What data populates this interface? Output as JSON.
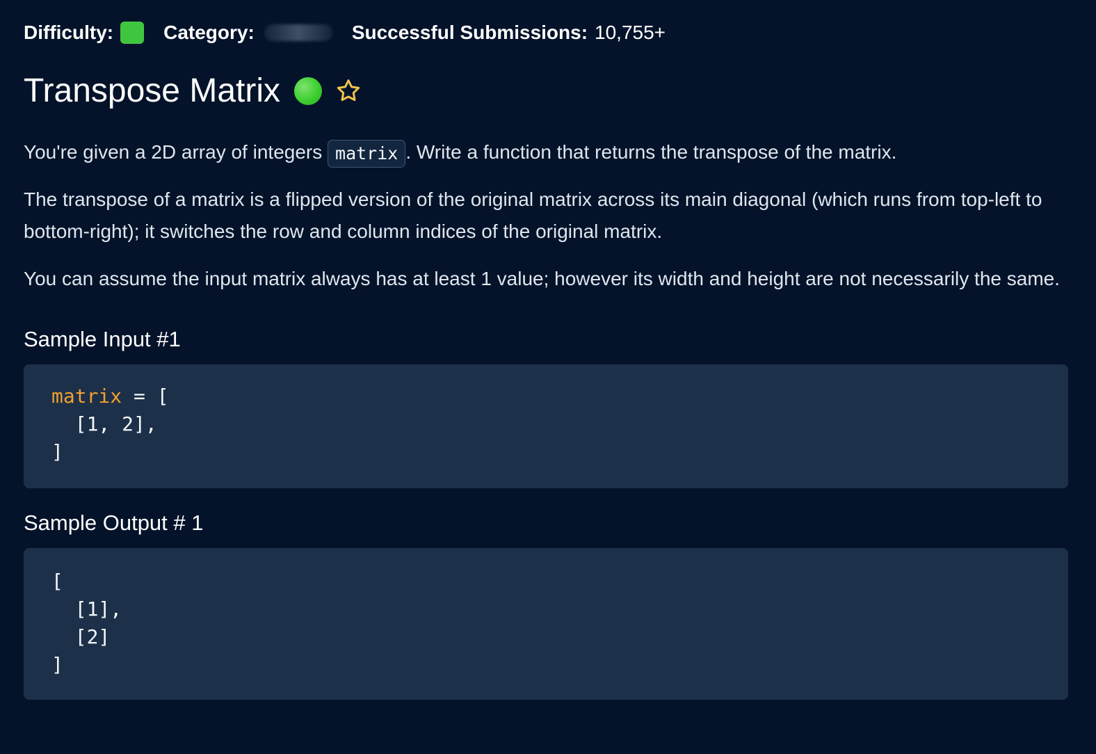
{
  "meta": {
    "difficulty_label": "Difficulty:",
    "category_label": "Category:",
    "submissions_label": "Successful Submissions:",
    "submissions_value": "10,755+",
    "colors": {
      "difficulty": "#3fc63f",
      "accent_orange": "#f0a12e"
    },
    "icons": {
      "difficulty": "difficulty-box",
      "category_hidden": "blurred-category"
    }
  },
  "title": {
    "text": "Transpose Matrix",
    "icons": {
      "status": "green-dot-icon",
      "favorite": "star-icon"
    }
  },
  "description": {
    "p1_before": "You're given a 2D array of integers ",
    "p1_code": "matrix",
    "p1_after": ". Write a function that returns the transpose of the matrix.",
    "p2": "The transpose of a matrix is a flipped version of the original matrix across its main diagonal (which runs from top-left to bottom-right); it switches the row and column indices of the original matrix.",
    "p3": "You can assume the input matrix always has at least 1 value; however its width and height are not necessarily the same."
  },
  "samples": {
    "input_heading": "Sample Input #1",
    "input_code": {
      "var_name": "matrix",
      "line1_rest": " = [",
      "line2": "  [1, 2],",
      "line3": "]"
    },
    "output_heading": "Sample Output # 1",
    "output_code": {
      "line1": "[",
      "line2": "  [1],",
      "line3": "  [2]",
      "line4": "]"
    }
  }
}
